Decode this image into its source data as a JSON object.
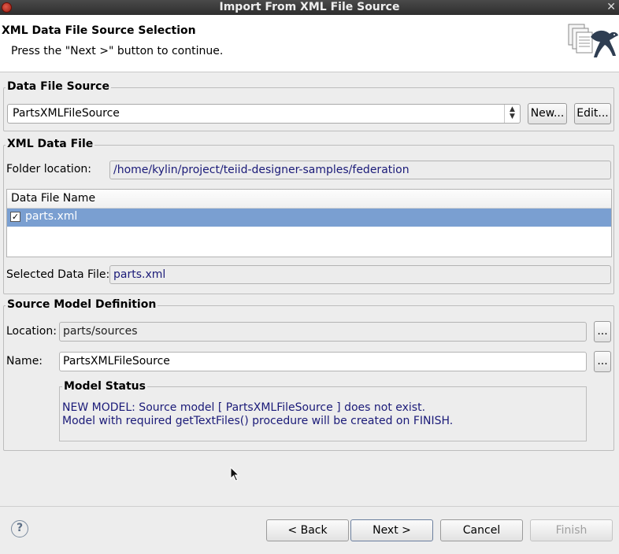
{
  "window": {
    "title": "Import From XML File Source"
  },
  "header": {
    "title": "XML Data File Source Selection",
    "message": "Press the \"Next >\" button to continue."
  },
  "data_file_source": {
    "group_label": "Data File Source",
    "selected": "PartsXMLFileSource",
    "new_label": "New...",
    "edit_label": "Edit..."
  },
  "xml_data_file": {
    "group_label": "XML Data File",
    "folder_label": "Folder location:",
    "folder_value": "/home/kylin/project/teiid-designer-samples/federation",
    "table_header": "Data File Name",
    "rows": [
      {
        "name": "parts.xml",
        "checked": true
      }
    ],
    "selected_label": "Selected Data File:",
    "selected_value": "parts.xml"
  },
  "source_model": {
    "group_label": "Source Model Definition",
    "location_label": "Location:",
    "location_value": "parts/sources",
    "name_label": "Name:",
    "name_value": "PartsXMLFileSource",
    "browse_label": "...",
    "status_label": "Model Status",
    "status_lines": [
      "NEW MODEL: Source model [ PartsXMLFileSource ] does not exist.",
      "Model with required getTextFiles() procedure will be created on FINISH."
    ]
  },
  "buttons": {
    "help": "?",
    "back": "< Back",
    "next": "Next >",
    "cancel": "Cancel",
    "finish": "Finish"
  }
}
